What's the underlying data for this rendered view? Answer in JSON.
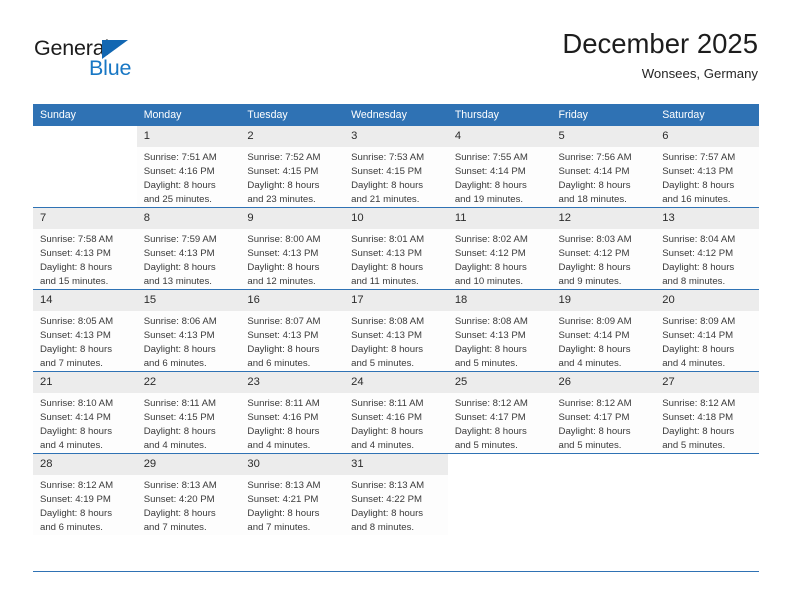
{
  "brand": {
    "name_part1": "General",
    "name_part2": "Blue",
    "triangle_icon": "triangle-icon",
    "color_dark": "#1c1c1c",
    "color_blue": "#1877c4"
  },
  "header": {
    "title": "December 2025",
    "location": "Wonsees, Germany"
  },
  "theme": {
    "header_blue": "#2f72b4",
    "daynum_gray": "#ececec",
    "text_dark": "#3a3a3a"
  },
  "weekday_headers": [
    "Sunday",
    "Monday",
    "Tuesday",
    "Wednesday",
    "Thursday",
    "Friday",
    "Saturday"
  ],
  "weeks": [
    [
      {
        "empty": true
      },
      {
        "day": "1",
        "sunrise": "Sunrise: 7:51 AM",
        "sunset": "Sunset: 4:16 PM",
        "daylight_line1": "Daylight: 8 hours",
        "daylight_line2": "and 25 minutes."
      },
      {
        "day": "2",
        "sunrise": "Sunrise: 7:52 AM",
        "sunset": "Sunset: 4:15 PM",
        "daylight_line1": "Daylight: 8 hours",
        "daylight_line2": "and 23 minutes."
      },
      {
        "day": "3",
        "sunrise": "Sunrise: 7:53 AM",
        "sunset": "Sunset: 4:15 PM",
        "daylight_line1": "Daylight: 8 hours",
        "daylight_line2": "and 21 minutes."
      },
      {
        "day": "4",
        "sunrise": "Sunrise: 7:55 AM",
        "sunset": "Sunset: 4:14 PM",
        "daylight_line1": "Daylight: 8 hours",
        "daylight_line2": "and 19 minutes."
      },
      {
        "day": "5",
        "sunrise": "Sunrise: 7:56 AM",
        "sunset": "Sunset: 4:14 PM",
        "daylight_line1": "Daylight: 8 hours",
        "daylight_line2": "and 18 minutes."
      },
      {
        "day": "6",
        "sunrise": "Sunrise: 7:57 AM",
        "sunset": "Sunset: 4:13 PM",
        "daylight_line1": "Daylight: 8 hours",
        "daylight_line2": "and 16 minutes."
      }
    ],
    [
      {
        "day": "7",
        "sunrise": "Sunrise: 7:58 AM",
        "sunset": "Sunset: 4:13 PM",
        "daylight_line1": "Daylight: 8 hours",
        "daylight_line2": "and 15 minutes."
      },
      {
        "day": "8",
        "sunrise": "Sunrise: 7:59 AM",
        "sunset": "Sunset: 4:13 PM",
        "daylight_line1": "Daylight: 8 hours",
        "daylight_line2": "and 13 minutes."
      },
      {
        "day": "9",
        "sunrise": "Sunrise: 8:00 AM",
        "sunset": "Sunset: 4:13 PM",
        "daylight_line1": "Daylight: 8 hours",
        "daylight_line2": "and 12 minutes."
      },
      {
        "day": "10",
        "sunrise": "Sunrise: 8:01 AM",
        "sunset": "Sunset: 4:13 PM",
        "daylight_line1": "Daylight: 8 hours",
        "daylight_line2": "and 11 minutes."
      },
      {
        "day": "11",
        "sunrise": "Sunrise: 8:02 AM",
        "sunset": "Sunset: 4:12 PM",
        "daylight_line1": "Daylight: 8 hours",
        "daylight_line2": "and 10 minutes."
      },
      {
        "day": "12",
        "sunrise": "Sunrise: 8:03 AM",
        "sunset": "Sunset: 4:12 PM",
        "daylight_line1": "Daylight: 8 hours",
        "daylight_line2": "and 9 minutes."
      },
      {
        "day": "13",
        "sunrise": "Sunrise: 8:04 AM",
        "sunset": "Sunset: 4:12 PM",
        "daylight_line1": "Daylight: 8 hours",
        "daylight_line2": "and 8 minutes."
      }
    ],
    [
      {
        "day": "14",
        "sunrise": "Sunrise: 8:05 AM",
        "sunset": "Sunset: 4:13 PM",
        "daylight_line1": "Daylight: 8 hours",
        "daylight_line2": "and 7 minutes."
      },
      {
        "day": "15",
        "sunrise": "Sunrise: 8:06 AM",
        "sunset": "Sunset: 4:13 PM",
        "daylight_line1": "Daylight: 8 hours",
        "daylight_line2": "and 6 minutes."
      },
      {
        "day": "16",
        "sunrise": "Sunrise: 8:07 AM",
        "sunset": "Sunset: 4:13 PM",
        "daylight_line1": "Daylight: 8 hours",
        "daylight_line2": "and 6 minutes."
      },
      {
        "day": "17",
        "sunrise": "Sunrise: 8:08 AM",
        "sunset": "Sunset: 4:13 PM",
        "daylight_line1": "Daylight: 8 hours",
        "daylight_line2": "and 5 minutes."
      },
      {
        "day": "18",
        "sunrise": "Sunrise: 8:08 AM",
        "sunset": "Sunset: 4:13 PM",
        "daylight_line1": "Daylight: 8 hours",
        "daylight_line2": "and 5 minutes."
      },
      {
        "day": "19",
        "sunrise": "Sunrise: 8:09 AM",
        "sunset": "Sunset: 4:14 PM",
        "daylight_line1": "Daylight: 8 hours",
        "daylight_line2": "and 4 minutes."
      },
      {
        "day": "20",
        "sunrise": "Sunrise: 8:09 AM",
        "sunset": "Sunset: 4:14 PM",
        "daylight_line1": "Daylight: 8 hours",
        "daylight_line2": "and 4 minutes."
      }
    ],
    [
      {
        "day": "21",
        "sunrise": "Sunrise: 8:10 AM",
        "sunset": "Sunset: 4:14 PM",
        "daylight_line1": "Daylight: 8 hours",
        "daylight_line2": "and 4 minutes."
      },
      {
        "day": "22",
        "sunrise": "Sunrise: 8:11 AM",
        "sunset": "Sunset: 4:15 PM",
        "daylight_line1": "Daylight: 8 hours",
        "daylight_line2": "and 4 minutes."
      },
      {
        "day": "23",
        "sunrise": "Sunrise: 8:11 AM",
        "sunset": "Sunset: 4:16 PM",
        "daylight_line1": "Daylight: 8 hours",
        "daylight_line2": "and 4 minutes."
      },
      {
        "day": "24",
        "sunrise": "Sunrise: 8:11 AM",
        "sunset": "Sunset: 4:16 PM",
        "daylight_line1": "Daylight: 8 hours",
        "daylight_line2": "and 4 minutes."
      },
      {
        "day": "25",
        "sunrise": "Sunrise: 8:12 AM",
        "sunset": "Sunset: 4:17 PM",
        "daylight_line1": "Daylight: 8 hours",
        "daylight_line2": "and 5 minutes."
      },
      {
        "day": "26",
        "sunrise": "Sunrise: 8:12 AM",
        "sunset": "Sunset: 4:17 PM",
        "daylight_line1": "Daylight: 8 hours",
        "daylight_line2": "and 5 minutes."
      },
      {
        "day": "27",
        "sunrise": "Sunrise: 8:12 AM",
        "sunset": "Sunset: 4:18 PM",
        "daylight_line1": "Daylight: 8 hours",
        "daylight_line2": "and 5 minutes."
      }
    ],
    [
      {
        "day": "28",
        "sunrise": "Sunrise: 8:12 AM",
        "sunset": "Sunset: 4:19 PM",
        "daylight_line1": "Daylight: 8 hours",
        "daylight_line2": "and 6 minutes."
      },
      {
        "day": "29",
        "sunrise": "Sunrise: 8:13 AM",
        "sunset": "Sunset: 4:20 PM",
        "daylight_line1": "Daylight: 8 hours",
        "daylight_line2": "and 7 minutes."
      },
      {
        "day": "30",
        "sunrise": "Sunrise: 8:13 AM",
        "sunset": "Sunset: 4:21 PM",
        "daylight_line1": "Daylight: 8 hours",
        "daylight_line2": "and 7 minutes."
      },
      {
        "day": "31",
        "sunrise": "Sunrise: 8:13 AM",
        "sunset": "Sunset: 4:22 PM",
        "daylight_line1": "Daylight: 8 hours",
        "daylight_line2": "and 8 minutes."
      },
      {
        "empty": true
      },
      {
        "empty": true
      },
      {
        "empty": true
      }
    ]
  ]
}
